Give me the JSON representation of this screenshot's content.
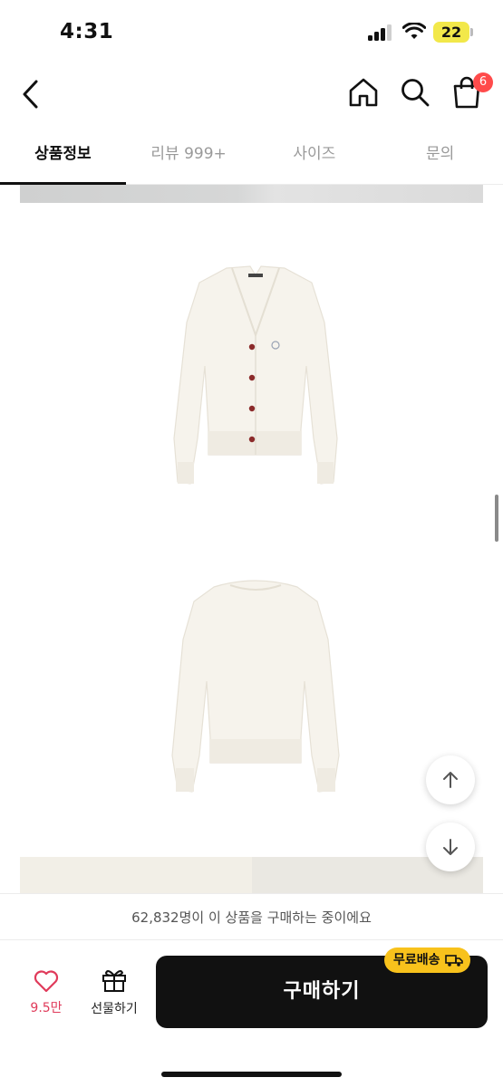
{
  "status_bar": {
    "time": "4:31",
    "battery": "22"
  },
  "header": {
    "cart_count": "6"
  },
  "tabs": [
    {
      "label": "상품정보",
      "active": true
    },
    {
      "label": "리뷰 999+",
      "active": false
    },
    {
      "label": "사이즈",
      "active": false
    },
    {
      "label": "문의",
      "active": false
    }
  ],
  "product": {
    "image_front": "cardigan-front-image",
    "image_back": "cardigan-back-image"
  },
  "notice": "62,832명이 이 상품을 구매하는 중이에요",
  "bottom_bar": {
    "like_count": "9.5만",
    "gift_label": "선물하기",
    "buy_label": "구매하기",
    "shipping_badge": "무료배송"
  },
  "colors": {
    "accent": "#111111",
    "badge": "#f8c21c",
    "like": "#e03a5a",
    "cart_badge": "#ff4b4b"
  }
}
